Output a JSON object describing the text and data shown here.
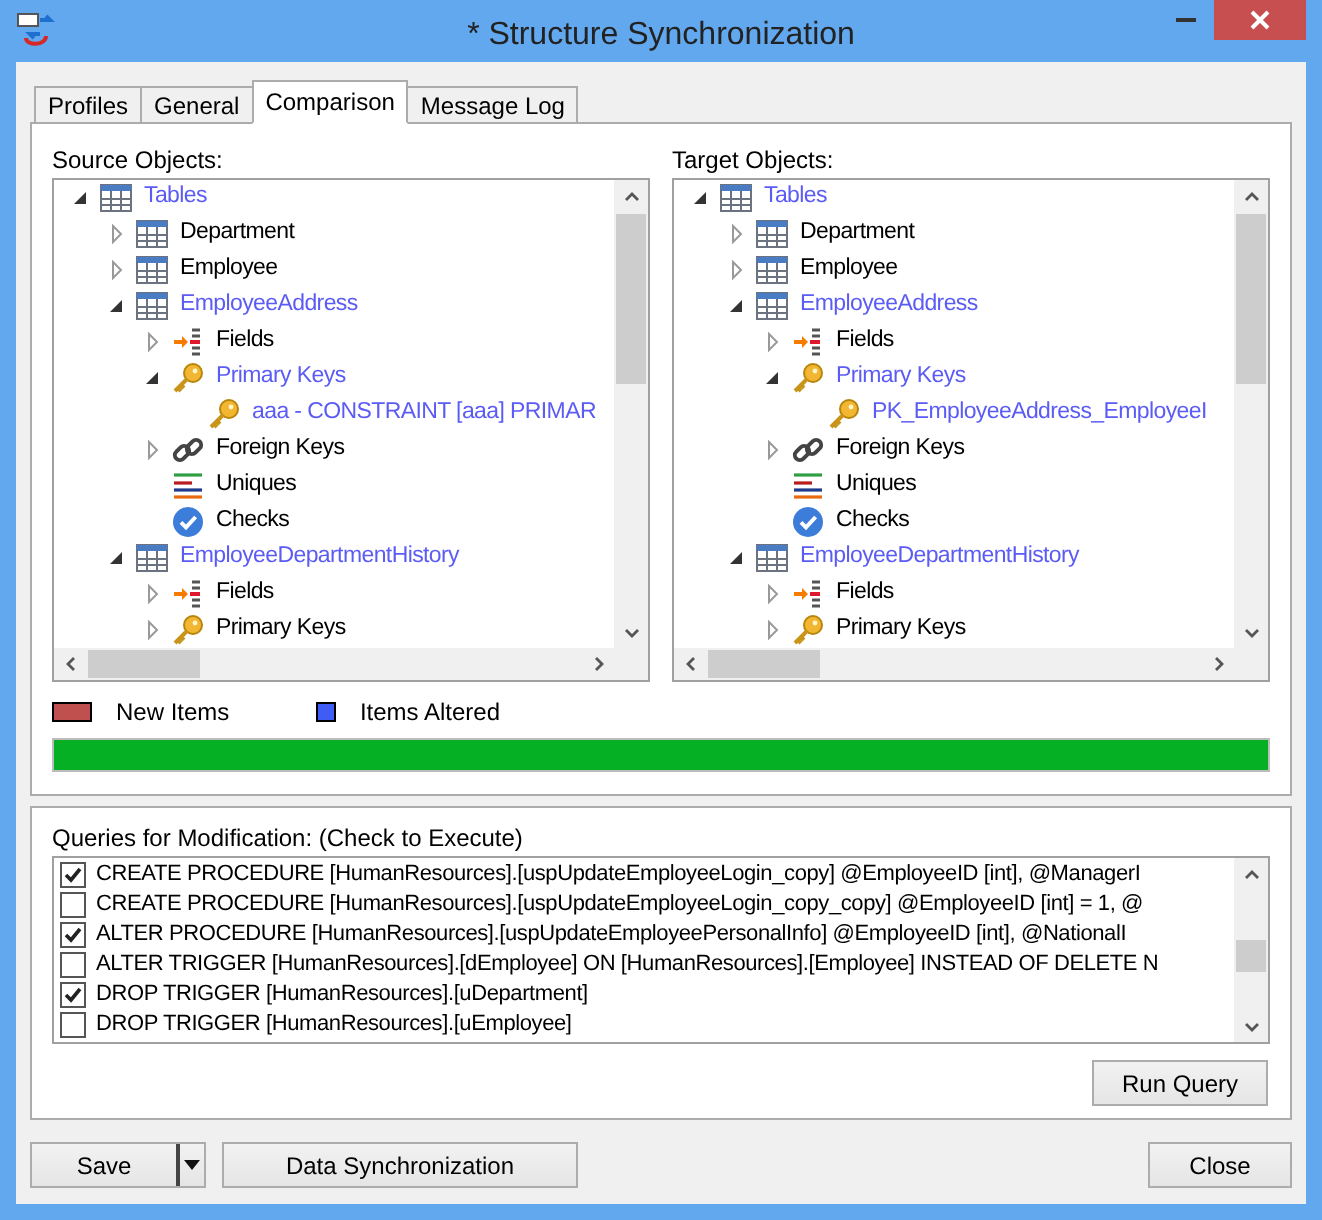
{
  "window": {
    "title": "* Structure Synchronization"
  },
  "tabs": [
    {
      "label": "Profiles",
      "selected": false
    },
    {
      "label": "General",
      "selected": false
    },
    {
      "label": "Comparison",
      "selected": true
    },
    {
      "label": "Message Log",
      "selected": false
    }
  ],
  "source_objects": {
    "label": "Source Objects:",
    "tree": [
      {
        "label": "Tables",
        "kind": "table",
        "altered": true,
        "expanded": true,
        "children": [
          {
            "label": "Department",
            "kind": "table",
            "altered": false,
            "expanded": false
          },
          {
            "label": "Employee",
            "kind": "table",
            "altered": false,
            "expanded": false
          },
          {
            "label": "EmployeeAddress",
            "kind": "table",
            "altered": true,
            "expanded": true,
            "children": [
              {
                "label": "Fields",
                "kind": "fields",
                "altered": false,
                "expanded": false
              },
              {
                "label": "Primary Keys",
                "kind": "key",
                "altered": true,
                "expanded": true,
                "children": [
                  {
                    "label": "aaa - CONSTRAINT [aaa] PRIMAR",
                    "kind": "key",
                    "altered": true
                  }
                ]
              },
              {
                "label": "Foreign Keys",
                "kind": "link",
                "altered": false,
                "expanded": false
              },
              {
                "label": "Uniques",
                "kind": "uniques",
                "altered": false
              },
              {
                "label": "Checks",
                "kind": "checks",
                "altered": false
              }
            ]
          },
          {
            "label": "EmployeeDepartmentHistory",
            "kind": "table",
            "altered": true,
            "expanded": true,
            "children": [
              {
                "label": "Fields",
                "kind": "fields",
                "altered": false,
                "expanded": false
              },
              {
                "label": "Primary Keys",
                "kind": "key",
                "altered": false,
                "expanded": false
              }
            ]
          }
        ]
      }
    ]
  },
  "target_objects": {
    "label": "Target Objects:",
    "tree": [
      {
        "label": "Tables",
        "kind": "table",
        "altered": true,
        "expanded": true,
        "children": [
          {
            "label": "Department",
            "kind": "table",
            "altered": false,
            "expanded": false
          },
          {
            "label": "Employee",
            "kind": "table",
            "altered": false,
            "expanded": false
          },
          {
            "label": "EmployeeAddress",
            "kind": "table",
            "altered": true,
            "expanded": true,
            "children": [
              {
                "label": "Fields",
                "kind": "fields",
                "altered": false,
                "expanded": false
              },
              {
                "label": "Primary Keys",
                "kind": "key",
                "altered": true,
                "expanded": true,
                "children": [
                  {
                    "label": "PK_EmployeeAddress_EmployeeI",
                    "kind": "key",
                    "altered": true
                  }
                ]
              },
              {
                "label": "Foreign Keys",
                "kind": "link",
                "altered": false,
                "expanded": false
              },
              {
                "label": "Uniques",
                "kind": "uniques",
                "altered": false
              },
              {
                "label": "Checks",
                "kind": "checks",
                "altered": false
              }
            ]
          },
          {
            "label": "EmployeeDepartmentHistory",
            "kind": "table",
            "altered": true,
            "expanded": true,
            "children": [
              {
                "label": "Fields",
                "kind": "fields",
                "altered": false,
                "expanded": false
              },
              {
                "label": "Primary Keys",
                "kind": "key",
                "altered": false,
                "expanded": false
              }
            ]
          }
        ]
      }
    ]
  },
  "legend": [
    {
      "label": "New Items",
      "color": "#c0504d"
    },
    {
      "label": "Items Altered",
      "color": "#3f5cf5"
    }
  ],
  "progress": {
    "level": 1
  },
  "queries": {
    "label": "Queries for Modification: (Check to Execute)",
    "items": [
      {
        "text": "CREATE PROCEDURE [HumanResources].[uspUpdateEmployeeLogin_copy] @EmployeeID [int],  @ManagerI",
        "checked": true
      },
      {
        "text": "CREATE PROCEDURE [HumanResources].[uspUpdateEmployeeLogin_copy_copy] @EmployeeID [int] = 1,  @",
        "checked": false
      },
      {
        "text": "ALTER PROCEDURE [HumanResources].[uspUpdateEmployeePersonalInfo] @EmployeeID [int],  @NationalI",
        "checked": true
      },
      {
        "text": "ALTER TRIGGER [HumanResources].[dEmployee] ON [HumanResources].[Employee] INSTEAD OF DELETE N",
        "checked": false
      },
      {
        "text": "DROP TRIGGER [HumanResources].[uDepartment]",
        "checked": true
      },
      {
        "text": "DROP TRIGGER [HumanResources].[uEmployee]",
        "checked": false
      }
    ]
  },
  "run_button": "Run Query",
  "footer": {
    "save": "Save",
    "data_sync": "Data Synchronization",
    "close": "Close"
  }
}
